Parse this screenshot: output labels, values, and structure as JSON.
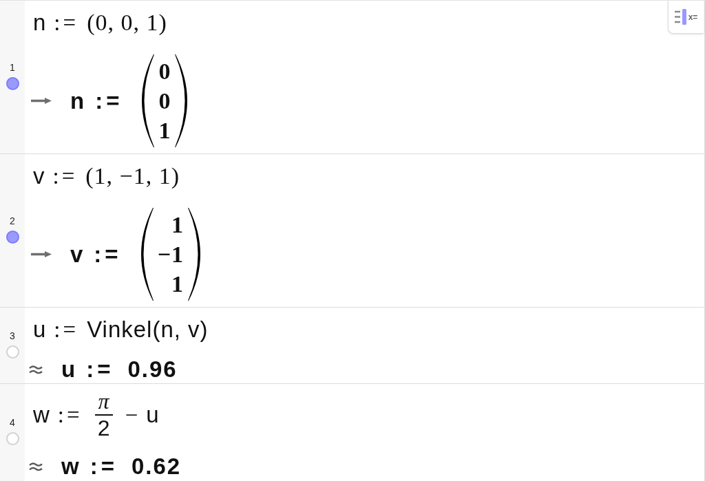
{
  "rows": [
    {
      "number": "1",
      "visible": true,
      "input": {
        "name": "n",
        "operator": ":=",
        "parts": [
          {
            "kind": "tuple",
            "text": "(0, 0, 1)"
          }
        ]
      },
      "output": {
        "kind": "exact",
        "name": "n",
        "operator": ":=",
        "vector": [
          "0",
          "0",
          "1"
        ]
      }
    },
    {
      "number": "2",
      "visible": true,
      "input": {
        "name": "v",
        "operator": ":=",
        "parts": [
          {
            "kind": "tuple",
            "text": "(1, −1, 1)"
          }
        ]
      },
      "output": {
        "kind": "exact",
        "name": "v",
        "operator": ":=",
        "vector": [
          "1",
          "−1",
          "1"
        ]
      }
    },
    {
      "number": "3",
      "visible": false,
      "input": {
        "name": "u",
        "operator": ":=",
        "parts": [
          {
            "kind": "text",
            "text": "Vinkel(n, v)"
          }
        ]
      },
      "output": {
        "kind": "approximate",
        "name": "u",
        "operator": ":=",
        "value": "0.96"
      }
    },
    {
      "number": "4",
      "visible": false,
      "input": {
        "name": "w",
        "operator": ":=",
        "parts": [
          {
            "kind": "fraction",
            "numerator": "π",
            "denominator": "2"
          },
          {
            "kind": "symbol",
            "text": "−"
          },
          {
            "kind": "text",
            "text": "u"
          }
        ]
      },
      "output": {
        "kind": "approximate",
        "name": "w",
        "operator": ":=",
        "value": "0.62"
      }
    }
  ],
  "view_toggle": {
    "label": "x="
  }
}
